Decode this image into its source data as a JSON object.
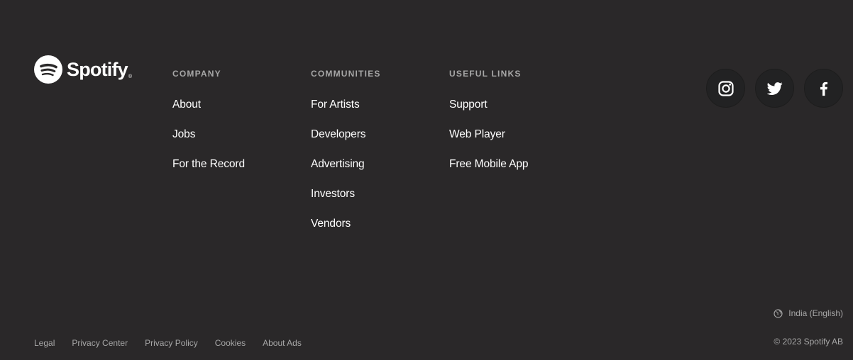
{
  "brand": {
    "name": "Spotify",
    "trademark": "®"
  },
  "columns": [
    {
      "heading": "COMPANY",
      "links": [
        "About",
        "Jobs",
        "For the Record"
      ]
    },
    {
      "heading": "COMMUNITIES",
      "links": [
        "For Artists",
        "Developers",
        "Advertising",
        "Investors",
        "Vendors"
      ]
    },
    {
      "heading": "USEFUL LINKS",
      "links": [
        "Support",
        "Web Player",
        "Free Mobile App"
      ]
    }
  ],
  "social": [
    {
      "icon": "instagram-icon"
    },
    {
      "icon": "twitter-icon"
    },
    {
      "icon": "facebook-icon"
    }
  ],
  "region": {
    "icon": "globe-icon",
    "label": "India (English)"
  },
  "legal_links": [
    "Legal",
    "Privacy Center",
    "Privacy Policy",
    "Cookies",
    "About Ads"
  ],
  "copyright": "© 2023 Spotify AB",
  "colors": {
    "background": "#2a2829",
    "heading": "#a7a7a7",
    "link": "#ffffff",
    "social_bg": "#222223"
  }
}
